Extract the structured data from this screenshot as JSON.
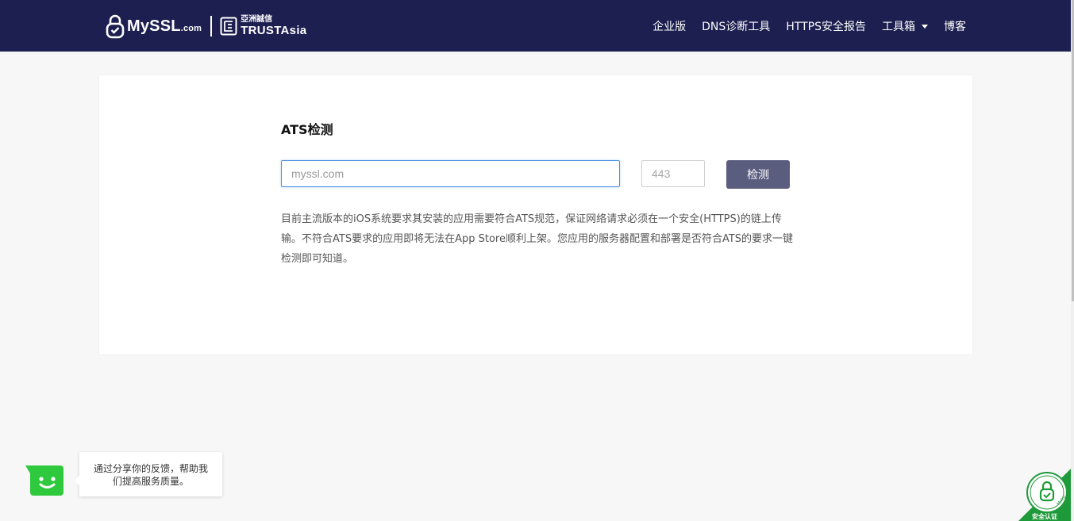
{
  "header": {
    "brand": "MySSL",
    "brand_suffix": ".com",
    "partner_cn": "亞洲誠信",
    "partner_en": "TRUSTAsia",
    "nav": [
      {
        "label": "企业版"
      },
      {
        "label": "DNS诊断工具"
      },
      {
        "label": "HTTPS安全报告"
      },
      {
        "label": "工具箱",
        "has_dropdown": true
      },
      {
        "label": "博客"
      }
    ]
  },
  "main": {
    "title": "ATS检测",
    "domain_placeholder": "myssl.com",
    "port_placeholder": "443",
    "check_label": "检测",
    "description": "目前主流版本的iOS系统要求其安装的应用需要符合ATS规范，保证网络请求必须在一个安全(HTTPS)的链上传输。不符合ATS要求的应用即将无法在App Store顺利上架。您应用的服务器配置和部署是否符合ATS的要求一键检测即可知道。"
  },
  "feedback": {
    "line1": "通过分享你的反馈，帮助我",
    "line2": "们提高服务质量。"
  },
  "badge": {
    "text": "安全认证",
    "ring_text": "MySSL.com"
  },
  "colors": {
    "header_bg": "#1c1f4f",
    "button_bg": "#5b5d7e",
    "input_focus": "#4a90e2",
    "feedback_green": "#2ec93c",
    "badge_green": "#1f9a3a"
  }
}
